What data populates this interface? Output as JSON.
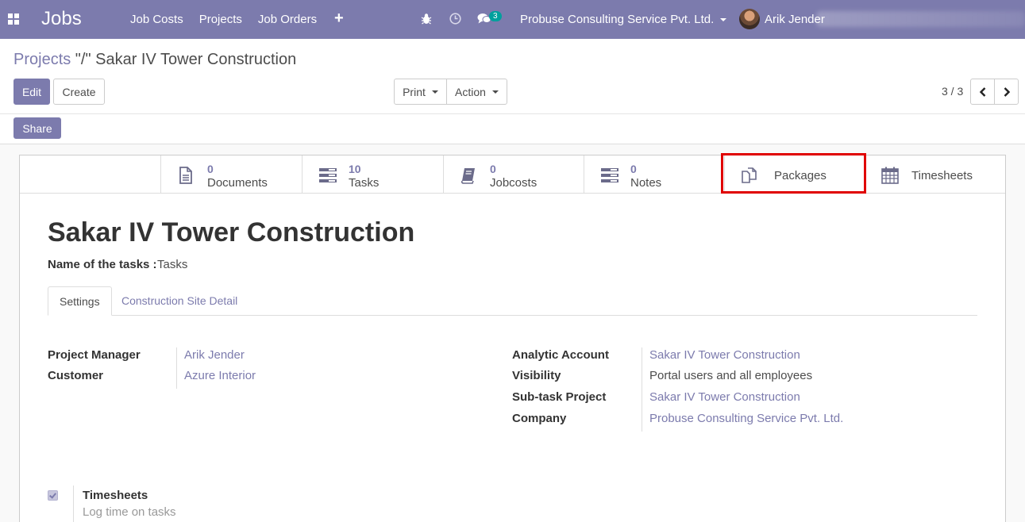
{
  "navbar": {
    "brand": "Jobs",
    "menu": [
      "Job Costs",
      "Projects",
      "Job Orders"
    ],
    "plus": "+",
    "chat_count": "3",
    "company": "Probuse Consulting Service Pvt. Ltd.",
    "user": "Arik Jender",
    "background": "#7c7bad"
  },
  "control_panel": {
    "breadcrumb_parent": "Projects",
    "breadcrumb_sep": " \"/\" ",
    "breadcrumb_current": "Sakar IV Tower Construction",
    "edit_label": "Edit",
    "create_label": "Create",
    "print_label": "Print",
    "action_label": "Action",
    "pager": "3 / 3",
    "share_label": "Share"
  },
  "button_box": {
    "documents": {
      "value": "0",
      "label": "Documents",
      "icon": "document-icon"
    },
    "tasks": {
      "value": "10",
      "label": "Tasks",
      "icon": "tasks-icon"
    },
    "jobcosts": {
      "value": "0",
      "label": "Jobcosts",
      "icon": "book-icon"
    },
    "notes": {
      "value": "0",
      "label": "Notes",
      "icon": "notes-icon"
    },
    "packages": {
      "label": "Packages",
      "icon": "copy-icon"
    },
    "timesheets": {
      "label": "Timesheets",
      "icon": "calendar-icon"
    },
    "highlight_color": "#e00000"
  },
  "form": {
    "title": "Sakar IV Tower Construction",
    "tasks_label": "Name of the tasks :",
    "tasks_value": "Tasks",
    "tabs": [
      "Settings",
      "Construction Site Detail"
    ],
    "left_fields": [
      {
        "label": "Project Manager",
        "value": "Arik Jender"
      },
      {
        "label": "Customer",
        "value": "Azure Interior"
      }
    ],
    "right_fields": [
      {
        "label": "Analytic Account",
        "value": "Sakar IV Tower Construction"
      },
      {
        "label": "Visibility",
        "value": "Portal users and all employees"
      },
      {
        "label": "Sub-task Project",
        "value": "Sakar IV Tower Construction"
      },
      {
        "label": "Company",
        "value": "Probuse Consulting Service Pvt. Ltd."
      }
    ],
    "timesheets_label": "Timesheets",
    "timesheets_help": "Log time on tasks",
    "timesheets_checked": true,
    "accent": "#7c7bad"
  }
}
